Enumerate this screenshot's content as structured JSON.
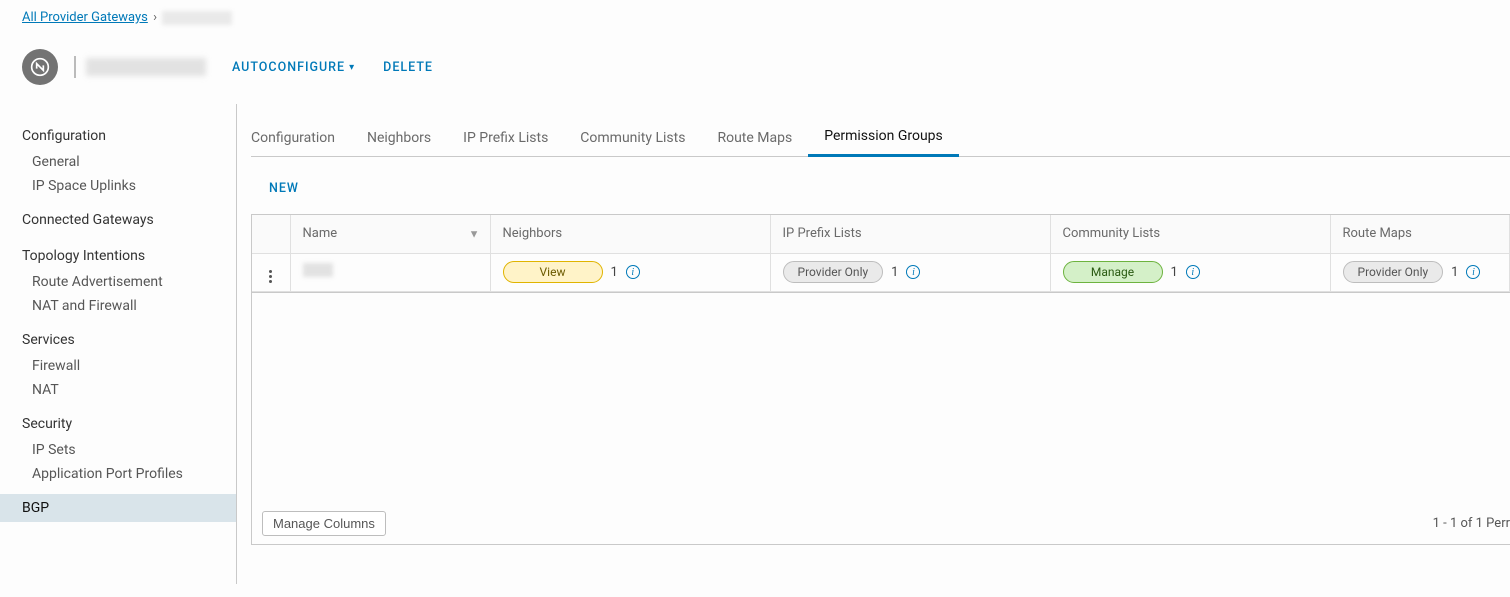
{
  "breadcrumb": {
    "root": "All Provider Gateways",
    "sep": "›"
  },
  "header": {
    "autoconfigure": "AUTOCONFIGURE",
    "delete": "DELETE"
  },
  "sidebar": {
    "groups": [
      {
        "label": "Configuration",
        "items": [
          "General",
          "IP Space Uplinks"
        ]
      },
      {
        "label": "Connected Gateways",
        "items": []
      },
      {
        "label": "Topology Intentions",
        "items": [
          "Route Advertisement",
          "NAT and Firewall"
        ]
      },
      {
        "label": "Services",
        "items": [
          "Firewall",
          "NAT"
        ]
      },
      {
        "label": "Security",
        "items": [
          "IP Sets",
          "Application Port Profiles"
        ]
      },
      {
        "label": "BGP",
        "items": [],
        "active": true
      }
    ]
  },
  "tabs": {
    "items": [
      "Configuration",
      "Neighbors",
      "IP Prefix Lists",
      "Community Lists",
      "Route Maps",
      "Permission Groups"
    ],
    "activeIndex": 5
  },
  "toolbar": {
    "new": "NEW"
  },
  "table": {
    "headers": {
      "name": "Name",
      "neighbors": "Neighbors",
      "ipPrefixLists": "IP Prefix Lists",
      "communityLists": "Community Lists",
      "routeMaps": "Route Maps"
    },
    "rows": [
      {
        "neighbors": {
          "badge": "View",
          "style": "yellow",
          "count": "1"
        },
        "ipPrefix": {
          "badge": "Provider Only",
          "style": "grey",
          "count": "1"
        },
        "community": {
          "badge": "Manage",
          "style": "green",
          "count": "1"
        },
        "routeMaps": {
          "badge": "Provider Only",
          "style": "grey",
          "count": "1"
        }
      }
    ],
    "footer": {
      "manageColumns": "Manage Columns",
      "paging": "1 - 1 of 1 Perr"
    }
  }
}
